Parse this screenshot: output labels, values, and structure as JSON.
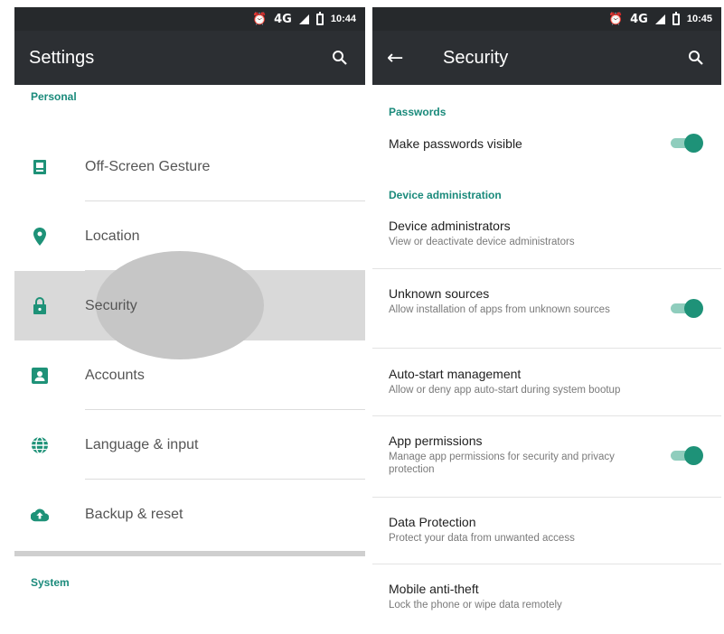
{
  "left": {
    "status": {
      "time": "10:44",
      "network": "4G"
    },
    "title": "Settings",
    "section_personal": "Personal",
    "items": [
      {
        "label": "Off-Screen Gesture",
        "icon": "gesture-icon"
      },
      {
        "label": "Location",
        "icon": "location-pin-icon"
      },
      {
        "label": "Security",
        "icon": "lock-icon"
      },
      {
        "label": "Accounts",
        "icon": "account-icon"
      },
      {
        "label": "Language & input",
        "icon": "globe-icon"
      },
      {
        "label": "Backup & reset",
        "icon": "cloud-upload-icon"
      }
    ],
    "section_system": "System"
  },
  "right": {
    "status": {
      "time": "10:45",
      "network": "4G"
    },
    "title": "Security",
    "sections": {
      "passwords": "Passwords",
      "device_admin": "Device administration"
    },
    "prefs": [
      {
        "title": "Make passwords visible",
        "summary": "",
        "toggle": true
      },
      {
        "title": "Device administrators",
        "summary": "View or deactivate device administrators",
        "toggle": false
      },
      {
        "title": "Unknown sources",
        "summary": "Allow installation of apps from unknown sources",
        "toggle": true
      },
      {
        "title": "Auto-start management",
        "summary": "Allow or deny app auto-start during system bootup",
        "toggle": false
      },
      {
        "title": "App permissions",
        "summary": "Manage app permissions for security and privacy protection",
        "toggle": true
      },
      {
        "title": "Data Protection",
        "summary": "Protect your data from unwanted access",
        "toggle": false
      },
      {
        "title": "Mobile anti-theft",
        "summary": "Lock the phone or wipe data remotely",
        "toggle": false
      }
    ]
  },
  "colors": {
    "accent": "#1e9278",
    "toolbar": "#2c2f33",
    "statusbar": "#26292c"
  }
}
